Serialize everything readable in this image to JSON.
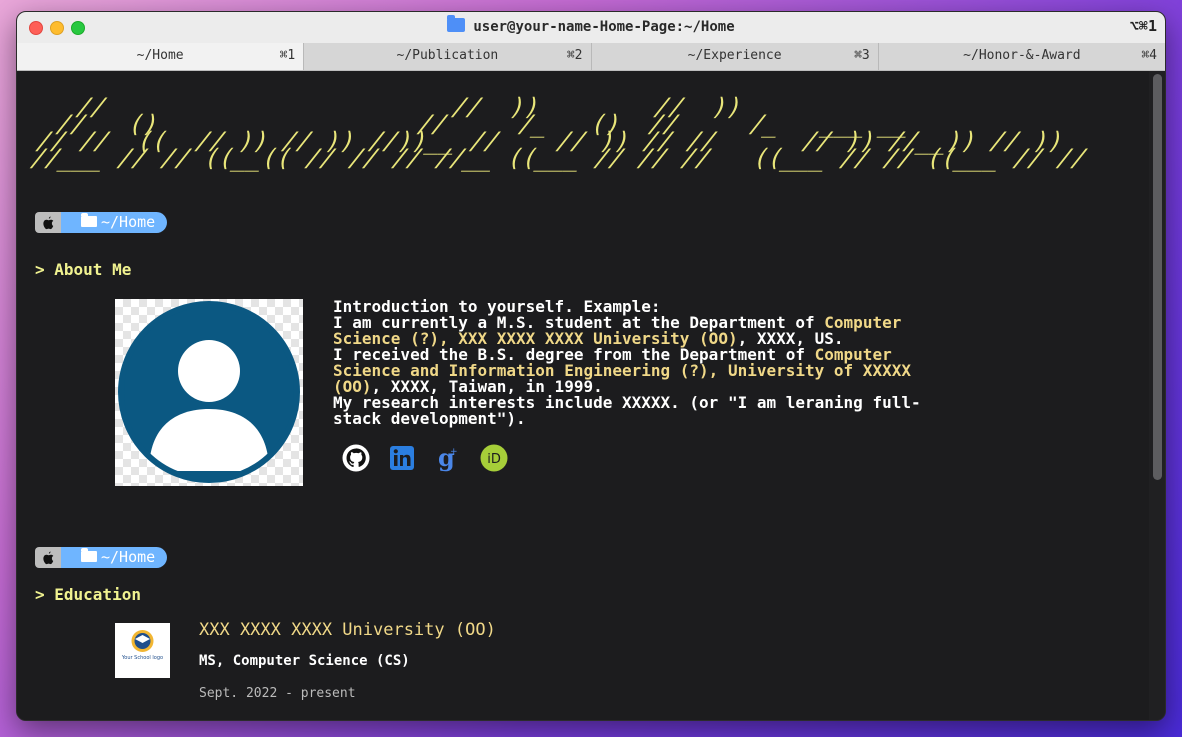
{
  "window": {
    "title": "user@your-name-Home-Page:~/Home",
    "shortcut": "⌥⌘1"
  },
  "tabs": [
    {
      "label": "~/Home",
      "shortcut": "⌘1"
    },
    {
      "label": "~/Publication",
      "shortcut": "⌘2"
    },
    {
      "label": "~/Experience",
      "shortcut": "⌘3"
    },
    {
      "label": "~/Honor-&-Award",
      "shortcut": "⌘4"
    }
  ],
  "banner": {
    "ascii": "  //                        //  ))        //  ))\n //   ()                  //     /_   ()  //     /_   ___ __\n// //  ((  // )) // )) //))__ //    // )) // //      // )) //__)) // ))\n//___ // // ((__(( // // // //__ ((___ // // //   ((___ // // ((___ // //"
  },
  "about": {
    "prompt_path": "~/Home",
    "heading": "> About Me",
    "intro": [
      [
        {
          "t": "Introduction to yourself. Example:"
        }
      ],
      [
        {
          "t": "I am currently a M.S. student at the Department of "
        },
        {
          "t": "Computer",
          "hl": true
        }
      ],
      [
        {
          "t": "Science (?), XXX XXXX XXXX University (OO)",
          "hl": true
        },
        {
          "t": ", XXXX, US."
        }
      ],
      [
        {
          "t": "I received the B.S. degree from the Department of "
        },
        {
          "t": "Computer",
          "hl": true
        }
      ],
      [
        {
          "t": "Science and Information Engineering (?), University of XXXXX",
          "hl": true
        }
      ],
      [
        {
          "t": "(OO)",
          "hl": true
        },
        {
          "t": ", XXXX, Taiwan, in 1999."
        }
      ],
      [
        {
          "t": "My research interests include XXXXX. (or \"I am leraning full-"
        }
      ],
      [
        {
          "t": "stack development\")."
        }
      ]
    ],
    "socials": [
      "github-icon",
      "linkedin-icon",
      "google-scholar-icon",
      "orcid-icon"
    ]
  },
  "education": {
    "prompt_path": "~/Home",
    "heading": "> Education",
    "logo_text": "Your School logo",
    "school": "XXX XXXX XXXX University (OO)",
    "degree": "MS, Computer Science (CS)",
    "dates": "Sept. 2022 - present"
  }
}
